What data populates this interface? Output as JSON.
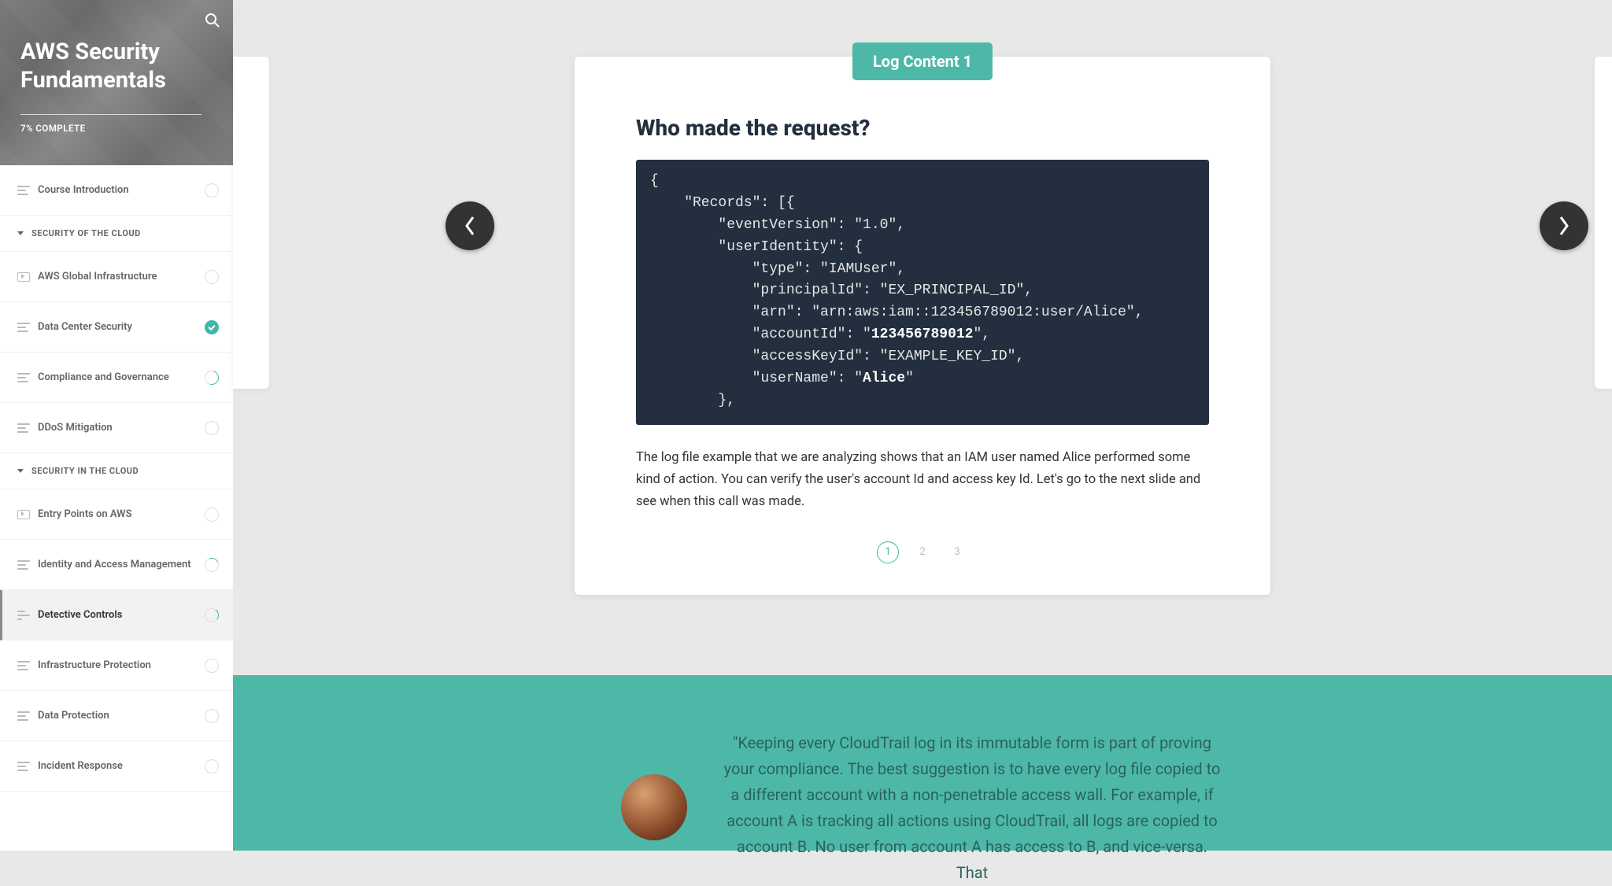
{
  "sidebar": {
    "course_title": "AWS Security Fundamentals",
    "progress_label": "7% COMPLETE",
    "sections": [
      {
        "type": "item",
        "icon": "lines",
        "label": "Course Introduction",
        "status": "none"
      },
      {
        "type": "section",
        "label": "SECURITY OF THE CLOUD"
      },
      {
        "type": "item",
        "icon": "video",
        "label": "AWS Global Infrastructure",
        "status": "none"
      },
      {
        "type": "item",
        "icon": "lines",
        "label": "Data Center Security",
        "status": "done"
      },
      {
        "type": "item",
        "icon": "lines",
        "label": "Compliance and Governance",
        "status": "partial"
      },
      {
        "type": "item",
        "icon": "lines",
        "label": "DDoS Mitigation",
        "status": "none"
      },
      {
        "type": "section",
        "label": "SECURITY IN THE CLOUD"
      },
      {
        "type": "item",
        "icon": "video",
        "label": "Entry Points on AWS",
        "status": "none"
      },
      {
        "type": "item",
        "icon": "lines",
        "label": "Identity and Access Management",
        "status": "partial2"
      },
      {
        "type": "item",
        "icon": "linesb",
        "label": "Detective Controls",
        "status": "partial3",
        "current": true
      },
      {
        "type": "item",
        "icon": "lines",
        "label": "Infrastructure Protection",
        "status": "none"
      },
      {
        "type": "item",
        "icon": "lines",
        "label": "Data Protection",
        "status": "none"
      },
      {
        "type": "item",
        "icon": "lines",
        "label": "Incident Response",
        "status": "none"
      }
    ]
  },
  "card": {
    "tag": "Log Content 1",
    "heading": "Who made the request?",
    "code_lines": [
      "{",
      "    \"Records\": [{",
      "        \"eventVersion\": \"1.0\",",
      "        \"userIdentity\": {",
      "            \"type\": \"IAMUser\",",
      "            \"principalId\": \"EX_PRINCIPAL_ID\",",
      "            \"arn\": \"arn:aws:iam::123456789012:user/Alice\",",
      "            \"accountId\": \"|B|123456789012|/B|\",",
      "            \"accessKeyId\": \"EXAMPLE_KEY_ID\",",
      "            \"userName\": \"|B|Alice|/B|\"",
      "        },"
    ],
    "paragraph": "The log file example that we are analyzing shows that an IAM user named Alice performed some kind of action. You can verify the user's account Id and access key Id. Let's go to the next slide and see when this call was made.",
    "pages": [
      "1",
      "2",
      "3"
    ],
    "active_page": 0
  },
  "quote": {
    "text": "\"Keeping every CloudTrail log in its immutable form is part of proving your compliance. The best suggestion is to have every log file copied to a different account with a non-penetrable access wall.  For example, if account A is tracking all actions using CloudTrail, all logs are copied to account B.  No user from account A has access to B, and vice-versa.  That"
  }
}
